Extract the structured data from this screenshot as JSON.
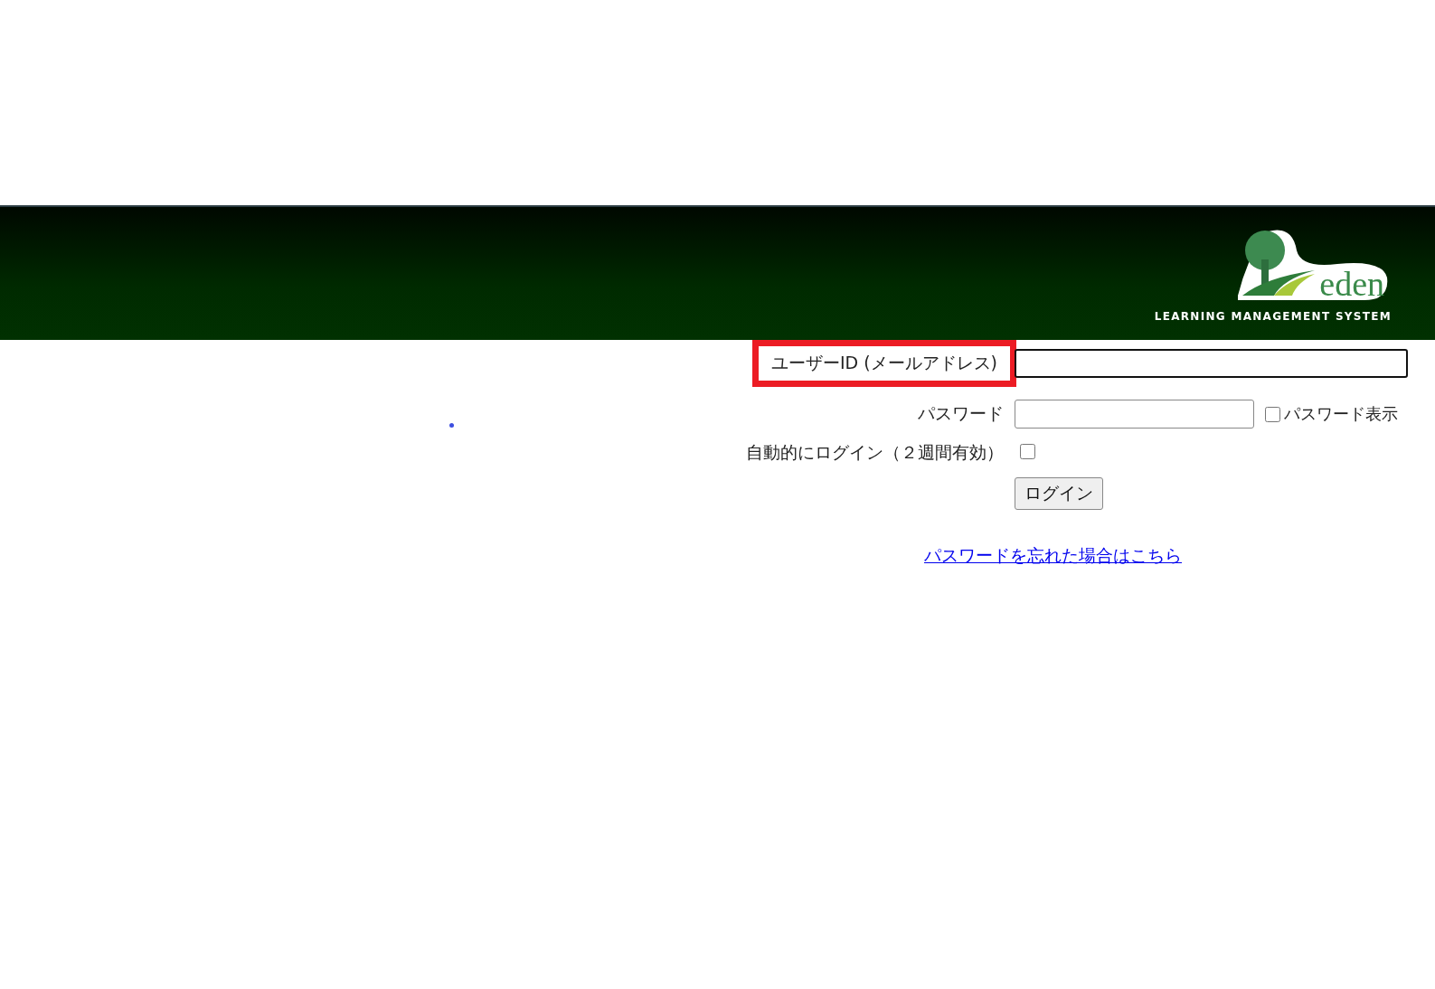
{
  "banner": {
    "logo_word": "eden",
    "tagline": "LEARNING MANAGEMENT SYSTEM"
  },
  "login_form": {
    "user_id": {
      "label": "ユーザーID (メールアドレス)",
      "highlighted": true,
      "focused": true
    },
    "password": {
      "label": "パスワード",
      "focused": false,
      "show_password": {
        "label": "パスワード表示",
        "checked": false
      }
    },
    "auto_login": {
      "label": "自動的にログイン（２週間有効）",
      "checked": false
    },
    "login_button": "ログイン",
    "forgot_link": "パスワードを忘れた場合はこちら"
  }
}
